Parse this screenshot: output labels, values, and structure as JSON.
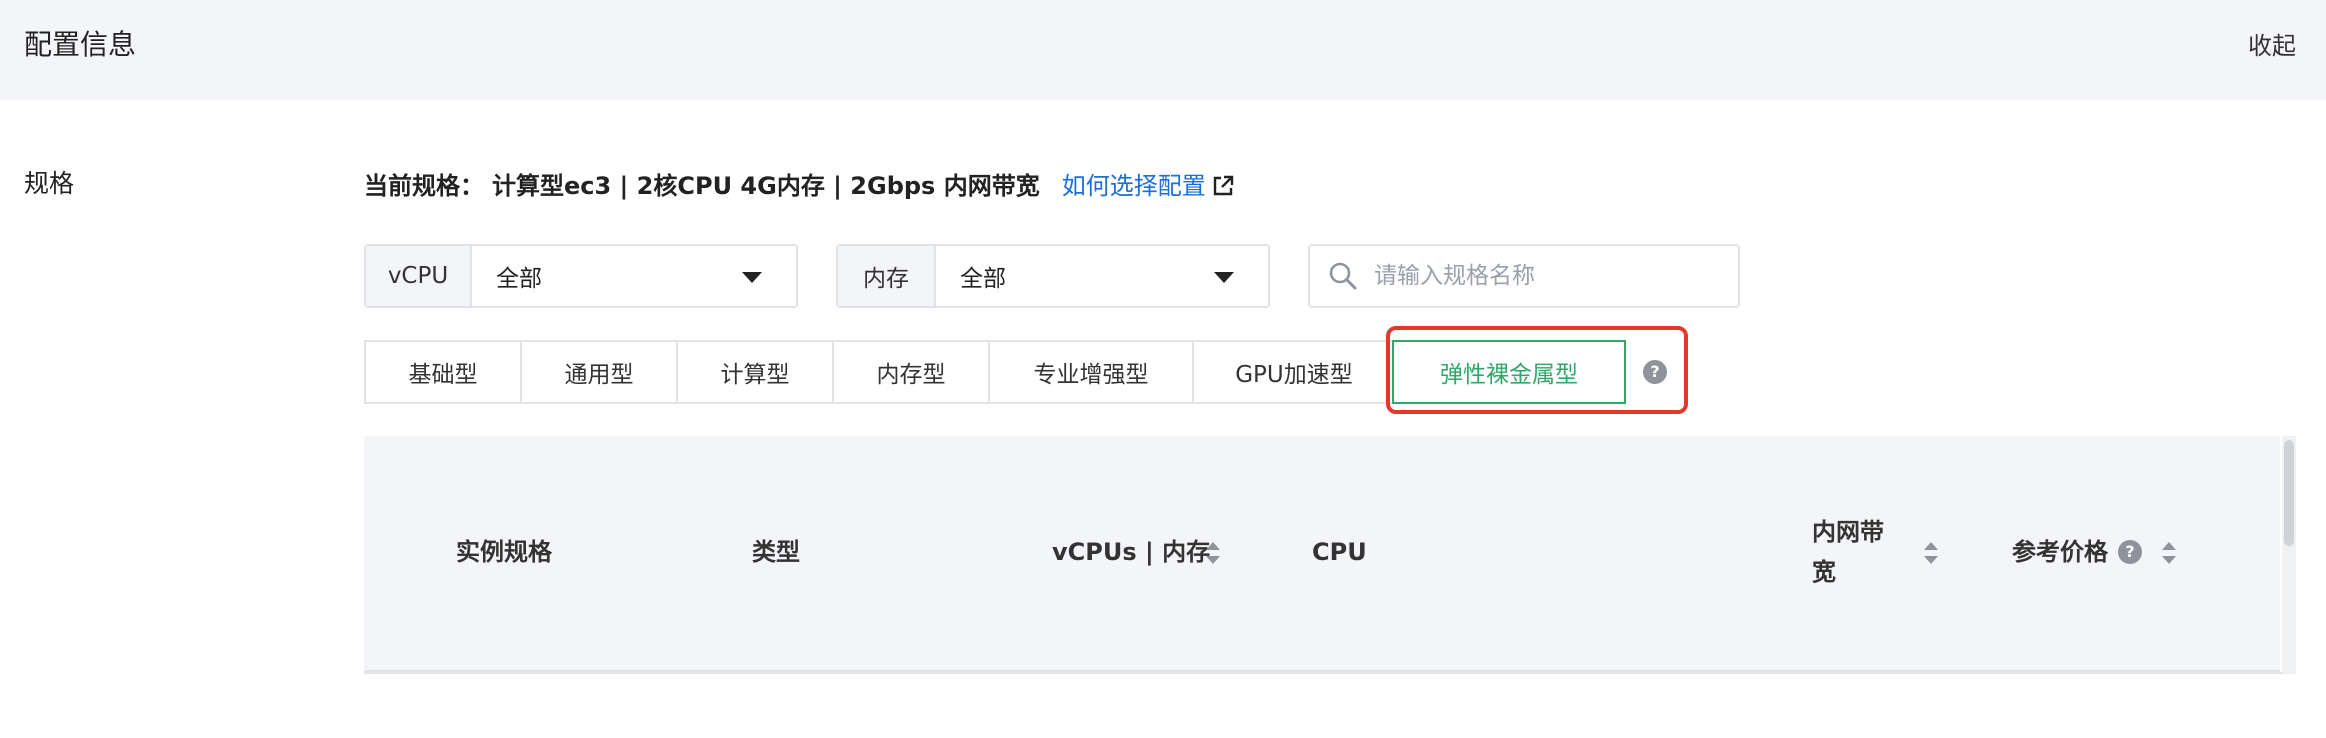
{
  "header": {
    "title": "配置信息",
    "collapse_label": "收起"
  },
  "spec": {
    "section_label": "规格",
    "current_label": "当前规格：",
    "current_value": "计算型ec3 | 2核CPU 4G内存 | 2Gbps 内网带宽",
    "howto_link": "如何选择配置"
  },
  "filters": {
    "vcpu": {
      "label": "vCPU",
      "value": "全部"
    },
    "memory": {
      "label": "内存",
      "value": "全部"
    },
    "search": {
      "placeholder": "请输入规格名称",
      "value": ""
    }
  },
  "tabs": [
    "基础型",
    "通用型",
    "计算型",
    "内存型",
    "专业增强型",
    "GPU加速型",
    "弹性裸金属型"
  ],
  "active_tab": "弹性裸金属型",
  "table": {
    "columns": [
      "实例规格",
      "类型",
      "vCPUs | 内存",
      "CPU",
      "内网带宽",
      "参考价格"
    ],
    "col_bandwidth_line1": "内网带",
    "col_bandwidth_line2": "宽"
  },
  "colors": {
    "accent": "#1a6fd8",
    "active_tab": "#2fa86a",
    "highlight_border": "#e03a2a"
  }
}
